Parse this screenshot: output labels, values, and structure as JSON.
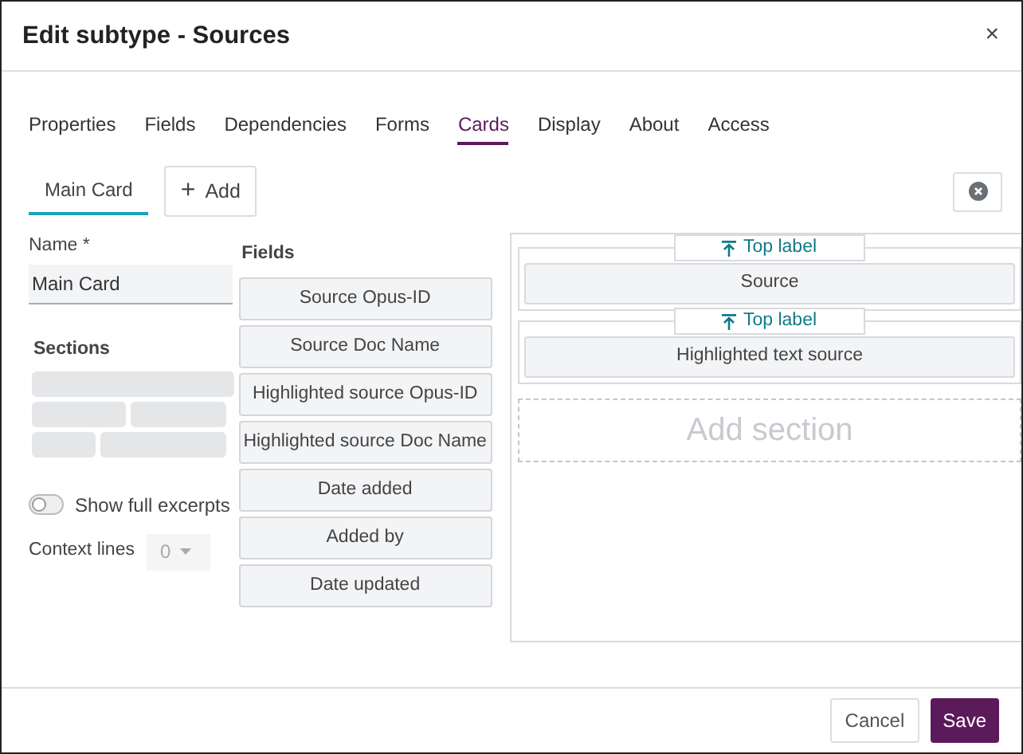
{
  "window": {
    "title": "Edit subtype - Sources",
    "close": "×"
  },
  "tabs": [
    {
      "label": "Properties",
      "selected": false
    },
    {
      "label": "Fields",
      "selected": false
    },
    {
      "label": "Dependencies",
      "selected": false
    },
    {
      "label": "Forms",
      "selected": false
    },
    {
      "label": "Cards",
      "selected": true
    },
    {
      "label": "Display",
      "selected": false
    },
    {
      "label": "About",
      "selected": false
    },
    {
      "label": "Access",
      "selected": false
    }
  ],
  "card_tabs": [
    {
      "label": "Main Card",
      "selected": true
    }
  ],
  "add_button": {
    "icon": "+",
    "label": "Add"
  },
  "name_field": {
    "label": "Name *",
    "value": "Main Card"
  },
  "sections": {
    "title": "Sections"
  },
  "show_full_excerpts": {
    "label": "Show full excerpts",
    "on": false
  },
  "context_lines": {
    "label": "Context lines",
    "value": "0",
    "disabled": true
  },
  "fields": {
    "title": "Fields",
    "items": [
      "Source Opus-ID",
      "Source Doc Name",
      "Highlighted source Opus-ID",
      "Highlighted source Doc Name",
      "Date added",
      "Added by",
      "Date updated"
    ]
  },
  "card_sections": [
    {
      "label_position": "Top label",
      "field": "Source"
    },
    {
      "label_position": "Top label",
      "field": "Highlighted text source"
    }
  ],
  "add_section": "Add section",
  "buttons": {
    "cancel": "Cancel",
    "save": "Save"
  }
}
